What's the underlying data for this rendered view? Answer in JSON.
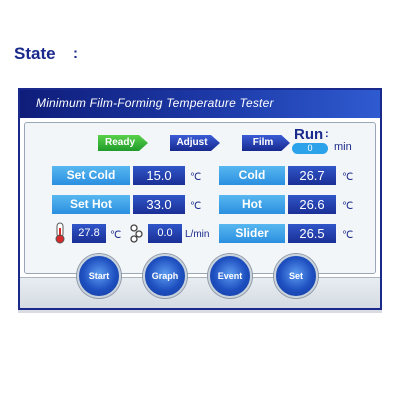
{
  "window": {
    "title": "Minimum Film-Forming Temperature Tester"
  },
  "state": {
    "label": "State",
    "colon": ":",
    "steps": [
      "Ready",
      "Adjust",
      "Film"
    ]
  },
  "run": {
    "label": "Run",
    "colon": ":",
    "value": "0",
    "unit": "min"
  },
  "readings": {
    "set_cold": {
      "label": "Set Cold",
      "value": "15.0",
      "unit": "℃"
    },
    "set_hot": {
      "label": "Set Hot",
      "value": "33.0",
      "unit": "℃"
    },
    "cold": {
      "label": "Cold",
      "value": "26.7",
      "unit": "℃"
    },
    "hot": {
      "label": "Hot",
      "value": "26.6",
      "unit": "℃"
    },
    "slider": {
      "label": "Slider",
      "value": "26.5",
      "unit": "℃"
    },
    "ambient_temp": {
      "value": "27.8",
      "unit": "℃",
      "icon": "thermometer-icon"
    },
    "flow": {
      "value": "0.0",
      "unit": "L/min",
      "icon": "flow-icon"
    }
  },
  "buttons": {
    "start": "Start",
    "graph": "Graph",
    "event": "Event",
    "set": "Set"
  },
  "colors": {
    "title_bar": "#1d3aa8",
    "label_box": "#2a8fe0",
    "value_box": "#1a2f96",
    "ready": "#1f9b2a",
    "step": "#16298f",
    "run_pill": "#2ba2ea"
  }
}
